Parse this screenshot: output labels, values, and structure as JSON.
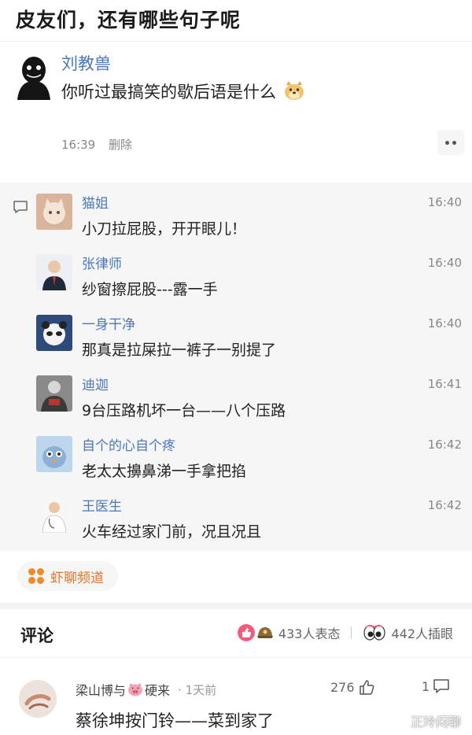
{
  "headline": "皮友们，还有哪些句子呢",
  "post": {
    "author": "刘教兽",
    "text": "你听过最搞笑的歇后语是什么",
    "time": "16:39",
    "delete_label": "删除"
  },
  "replies": [
    {
      "name": "猫姐",
      "time": "16:40",
      "text": "小刀拉屁股，开开眼儿！",
      "avatar": "cat-avatar"
    },
    {
      "name": "张律师",
      "time": "16:40",
      "text": "纱窗擦屁股---露一手",
      "avatar": "lawyer-avatar"
    },
    {
      "name": "一身干净",
      "time": "16:40",
      "text": "那真是拉屎拉一裤子一别提了",
      "avatar": "panda-avatar"
    },
    {
      "name": "迪迦",
      "time": "16:41",
      "text": "9台压路机坏一台——八个压路",
      "avatar": "figure-avatar"
    },
    {
      "name": "自个的心自个疼",
      "time": "16:42",
      "text": "老太太擤鼻涕一手拿把掐",
      "avatar": "bird-avatar"
    },
    {
      "name": "王医生",
      "time": "16:42",
      "text": "火车经过家门前，况且况且",
      "avatar": "doctor-avatar"
    }
  ],
  "channel_label": "虾聊频道",
  "comments_section": {
    "title": "评论",
    "reactions_label": "433人表态",
    "stares_label": "442人插眼"
  },
  "comment": {
    "user": "梁山博与",
    "user_suffix": "硬来",
    "ago": "· 1天前",
    "likes": "276",
    "reply_count": "1",
    "text": "蔡徐坤按门铃——菜到家了"
  },
  "watermark": "正玲闲聊",
  "colors": {
    "link_blue": "#4a78b8",
    "accent_orange": "#f08b2a",
    "panel_gray": "#f6f6f6"
  }
}
